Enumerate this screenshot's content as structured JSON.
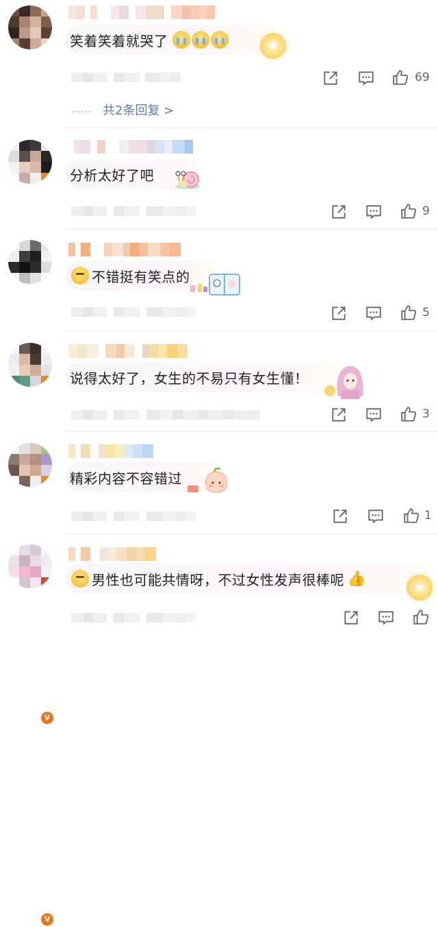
{
  "comments": [
    {
      "text": "笑着笑着就哭了",
      "likes": "69"
    },
    {
      "text": "分析太好了吧",
      "likes": "9"
    },
    {
      "text": "不错挺有笑点的",
      "likes": "5"
    },
    {
      "text": "说得太好了，女生的不易只有女生懂！",
      "likes": "3"
    },
    {
      "text": "精彩内容不容错过",
      "likes": "1"
    },
    {
      "text": "男性也可能共情呀，不过女性发声很棒呢",
      "likes": ""
    }
  ],
  "replies": {
    "dots": "……",
    "label": "共2条回复 >"
  },
  "icons": {
    "share": "share-icon",
    "comment": "comment-icon",
    "like": "thumbs-up-icon",
    "crying": "crying-emoji-icon",
    "thinking": "thinking-emoji-icon",
    "thumb": "thumbs-up-emoji-icon",
    "medal": "medal-badge-icon",
    "verified": "verified-badge-icon"
  },
  "colors": {
    "link": "#5b7db0",
    "icon": "#666666",
    "medal": "#f3c04a",
    "verified": "#e8771c"
  }
}
